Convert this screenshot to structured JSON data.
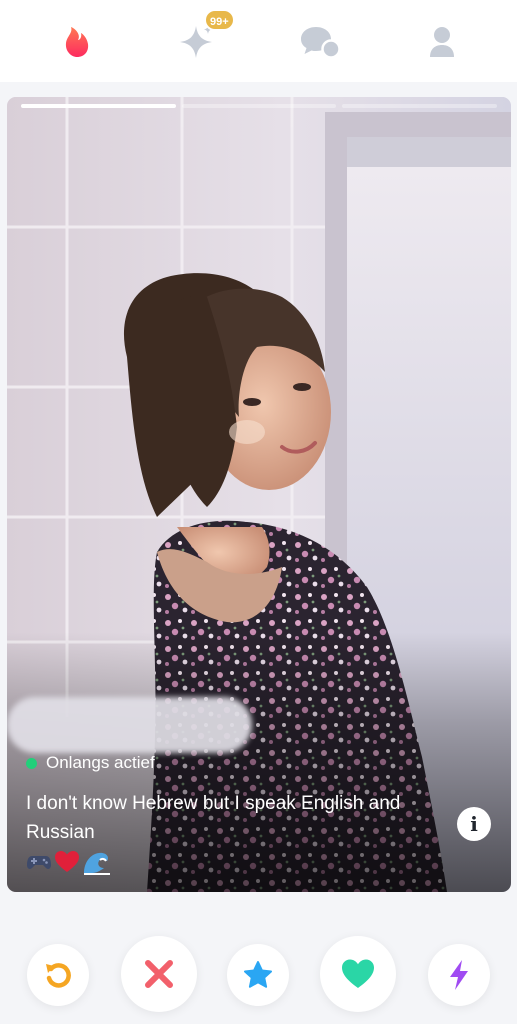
{
  "nav": {
    "items": [
      {
        "name": "flame-icon",
        "color": "#fd5068"
      },
      {
        "name": "sparkle-icon",
        "color": "#c6ccd6"
      },
      {
        "name": "chat-bubbles-icon",
        "color": "#c6ccd6"
      },
      {
        "name": "profile-icon",
        "color": "#c6ccd6"
      }
    ],
    "likes_badge": "99+"
  },
  "profile": {
    "photo_count": 3,
    "active_photo": 1,
    "status": "Onlangs actief",
    "status_color": "#21d07a",
    "bio": "I don't know Hebrew but I speak English and Russian",
    "emojis": [
      "game-controller-icon",
      "heart-emoji",
      "wave-emoji"
    ],
    "info_label": "i"
  },
  "actions": [
    {
      "name": "rewind-button",
      "icon": "rewind-icon",
      "color": "#f5a623"
    },
    {
      "name": "nope-button",
      "icon": "x-icon",
      "color": "#f2606b"
    },
    {
      "name": "super-like-button",
      "icon": "star-icon",
      "color": "#2aa6f3"
    },
    {
      "name": "like-button",
      "icon": "heart-icon",
      "color": "#2ad6a6"
    },
    {
      "name": "boost-button",
      "icon": "lightning-icon",
      "color": "#a04bf2"
    }
  ]
}
